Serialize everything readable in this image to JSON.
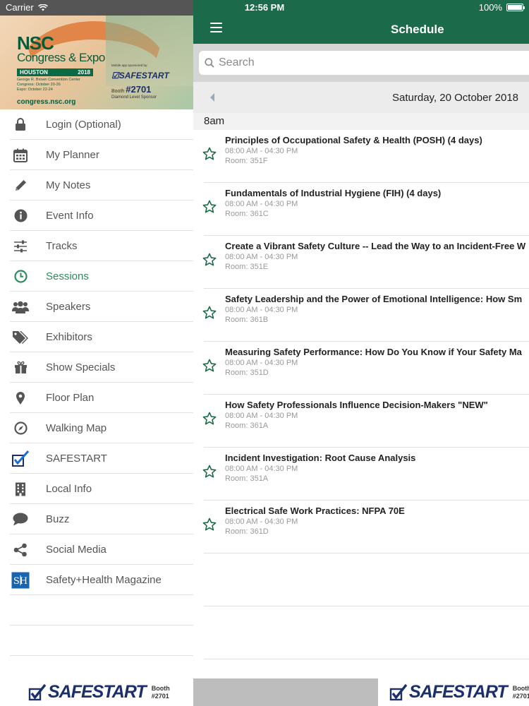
{
  "status_bar": {
    "carrier": "Carrier",
    "time": "12:56 PM",
    "battery": "100%"
  },
  "banner": {
    "nsc": "NSC",
    "congress": "Congress & Expo",
    "city": "HOUSTON",
    "year": "2018",
    "venue": "George R. Brown Convention Center",
    "congress_dates": "Congress: October 20-26",
    "expo_dates": "Expo: October 22-24",
    "url": "congress.nsc.org",
    "sponsor_note": "Mobile app sponsored by:",
    "sponsor": "SAFESTART",
    "booth_label": "Booth",
    "booth_number": "#2701",
    "level": "Diamond Level Sponsor"
  },
  "menu": {
    "items": [
      {
        "label": "Login (Optional)",
        "icon": "lock-icon"
      },
      {
        "label": "My Planner",
        "icon": "calendar-icon"
      },
      {
        "label": "My Notes",
        "icon": "pencil-icon"
      },
      {
        "label": "Event Info",
        "icon": "info-icon"
      },
      {
        "label": "Tracks",
        "icon": "sliders-icon"
      },
      {
        "label": "Sessions",
        "icon": "clock-icon"
      },
      {
        "label": "Speakers",
        "icon": "people-icon"
      },
      {
        "label": "Exhibitors",
        "icon": "tags-icon"
      },
      {
        "label": "Show Specials",
        "icon": "gift-icon"
      },
      {
        "label": "Floor Plan",
        "icon": "map-pin-icon"
      },
      {
        "label": "Walking Map",
        "icon": "compass-icon"
      },
      {
        "label": "SAFESTART",
        "icon": "safestart-check-icon"
      },
      {
        "label": "Local Info",
        "icon": "building-icon"
      },
      {
        "label": "Buzz",
        "icon": "speech-bubble-icon"
      },
      {
        "label": "Social Media",
        "icon": "share-icon"
      },
      {
        "label": "Safety+Health Magazine",
        "icon": "sh-logo-icon"
      }
    ],
    "active": "Sessions",
    "active_color": "#2e8a5e"
  },
  "footer": {
    "logo": "SAFESTART",
    "booth_label": "Booth",
    "booth_number": "#2701"
  },
  "header": {
    "title": "Schedule",
    "color": "#1b6b4a"
  },
  "search": {
    "placeholder": "Search",
    "value": ""
  },
  "date": "Saturday, 20 October 2018",
  "time_group": "8am",
  "sessions": [
    {
      "title": "Principles of Occupational Safety & Health (POSH) (4 days)",
      "time": "08:00 AM - 04:30 PM",
      "room": "Room: 351F"
    },
    {
      "title": "Fundamentals of Industrial Hygiene (FIH) (4 days)",
      "time": "08:00 AM - 04:30 PM",
      "room": "Room: 361C"
    },
    {
      "title": "Create a Vibrant Safety Culture -- Lead the Way to an Incident-Free W",
      "time": "08:00 AM - 04:30 PM",
      "room": "Room: 351E"
    },
    {
      "title": "Safety Leadership and the Power of Emotional Intelligence: How Sm",
      "time": "08:00 AM - 04:30 PM",
      "room": "Room: 361B"
    },
    {
      "title": "Measuring Safety Performance: How Do You Know if Your Safety Ma",
      "time": "08:00 AM - 04:30 PM",
      "room": "Room: 351D"
    },
    {
      "title": "How Safety Professionals Influence Decision-Makers \"NEW\"",
      "time": "08:00 AM - 04:30 PM",
      "room": "Room: 361A"
    },
    {
      "title": "Incident Investigation: Root Cause Analysis",
      "time": "08:00 AM - 04:30 PM",
      "room": "Room: 351A"
    },
    {
      "title": "Electrical Safe Work Practices: NFPA 70E",
      "time": "08:00 AM - 04:30 PM",
      "room": "Room: 361D"
    }
  ]
}
